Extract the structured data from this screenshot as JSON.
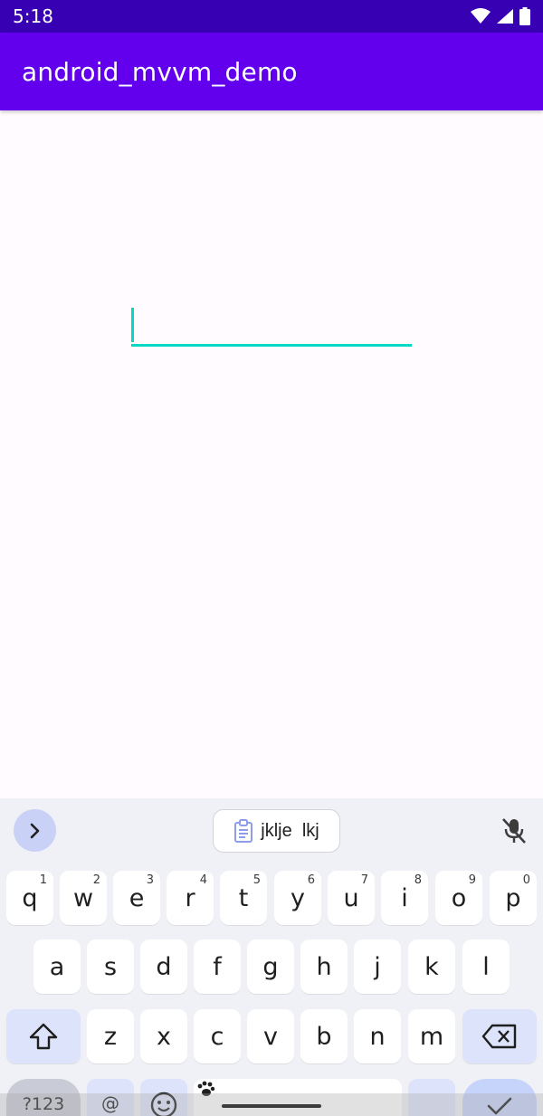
{
  "status_bar": {
    "time": "5:18",
    "icons": [
      "wifi-icon",
      "cell-signal-icon",
      "battery-icon"
    ]
  },
  "app_bar": {
    "title": "android_mvvm_demo"
  },
  "edit_text": {
    "value": ""
  },
  "keyboard": {
    "clipboard_suggestion": "jklje  lkj",
    "row1": [
      {
        "label": "q",
        "hint": "1"
      },
      {
        "label": "w",
        "hint": "2"
      },
      {
        "label": "e",
        "hint": "3"
      },
      {
        "label": "r",
        "hint": "4"
      },
      {
        "label": "t",
        "hint": "5"
      },
      {
        "label": "y",
        "hint": "6"
      },
      {
        "label": "u",
        "hint": "7"
      },
      {
        "label": "i",
        "hint": "8"
      },
      {
        "label": "o",
        "hint": "9"
      },
      {
        "label": "p",
        "hint": "0"
      }
    ],
    "row2": [
      "a",
      "s",
      "d",
      "f",
      "g",
      "h",
      "j",
      "k",
      "l"
    ],
    "row3": [
      "z",
      "x",
      "c",
      "v",
      "b",
      "n",
      "m"
    ],
    "row4": {
      "symbols_label": "?123",
      "at_label": "@"
    }
  },
  "colors": {
    "status_bar": "#3700b3",
    "app_bar": "#6200ee",
    "accent": "#03dac5",
    "keyboard_bg": "#f0f1f6"
  }
}
